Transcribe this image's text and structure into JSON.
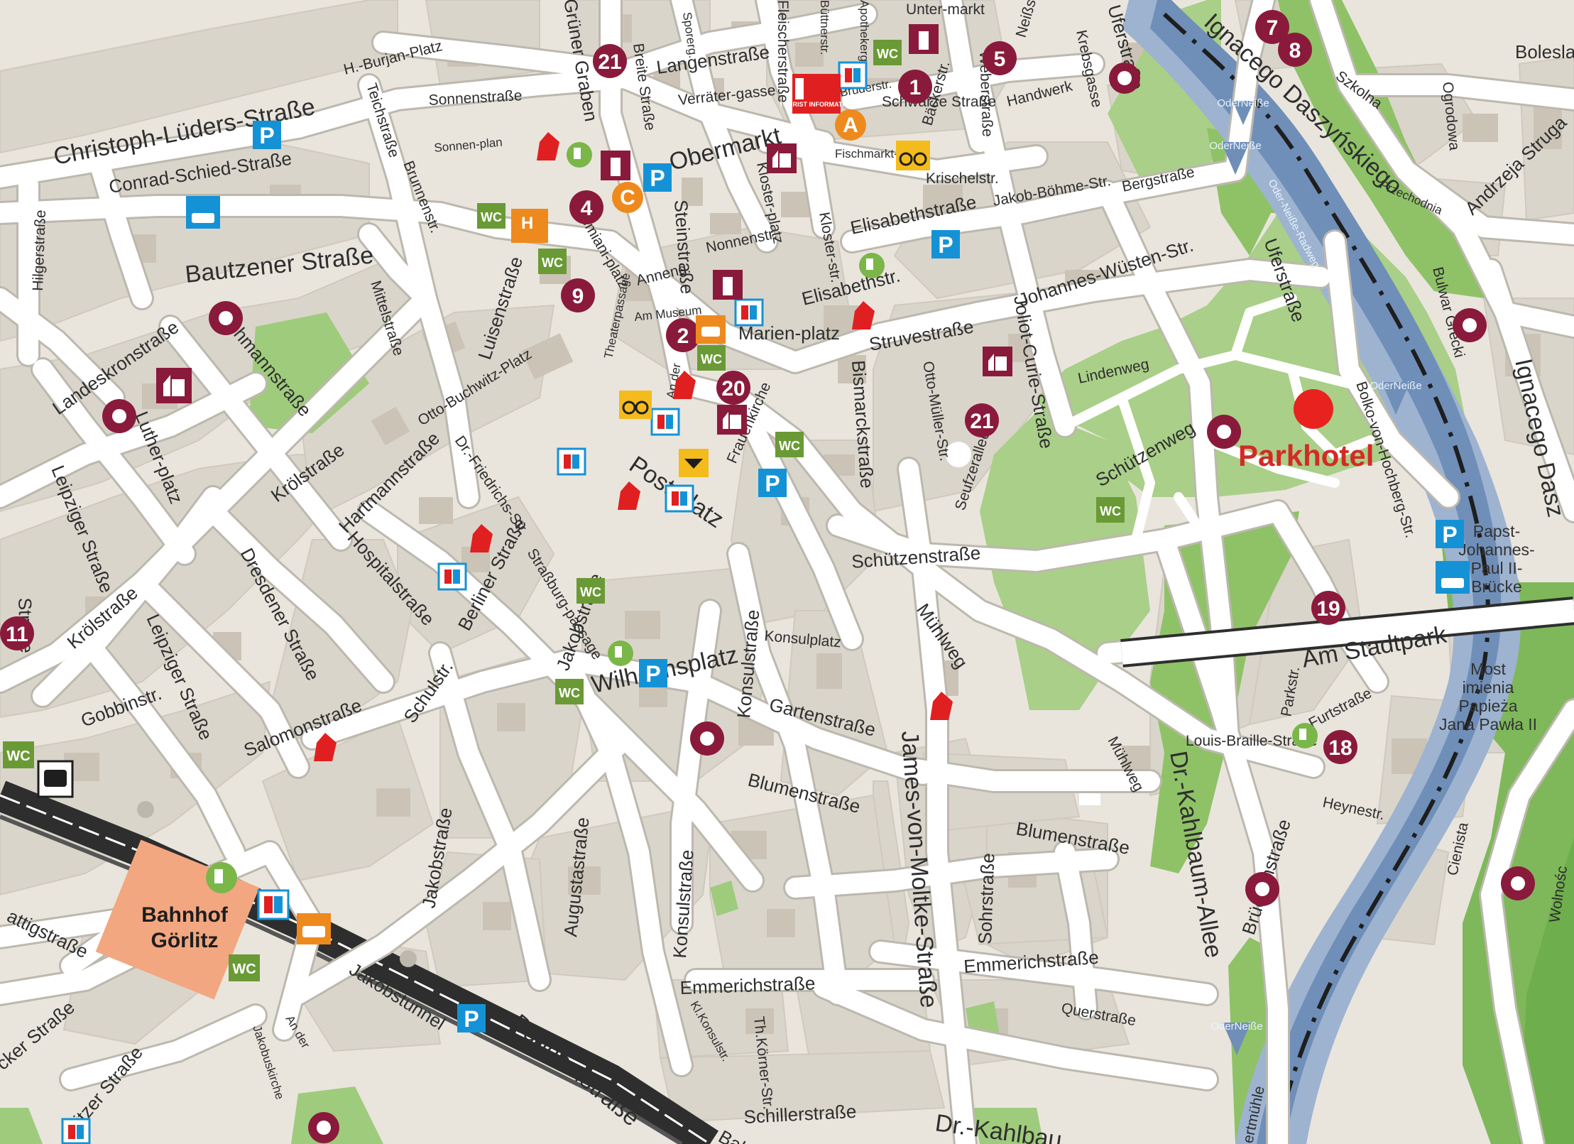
{
  "colors": {
    "background": "#e9e5dd",
    "block": "#dad5cb",
    "building": "#cfc8bc",
    "road": "#ffffff",
    "road_edge": "#bdb8ae",
    "park": "#8fc267",
    "park_light": "#b7d79c",
    "river": "#6f8fb8",
    "river_edge": "#9db3d0",
    "poi": "#8a1a3c",
    "parking": "#1592d6",
    "wc": "#6a9a35",
    "orange": "#ee8a1d",
    "yellow": "#f4bb1c",
    "pharmacy": "#e02020",
    "station": "#f3a780",
    "hotel": "#e8231f",
    "rail": "#2e2e2e"
  },
  "hotel": {
    "label": "Parkhotel"
  },
  "station": {
    "line1": "Bahnhof",
    "line2": "Görlitz"
  },
  "bridge": {
    "name_de": [
      "Papst-",
      "Johannes-",
      "Paul II-",
      "Brücke"
    ],
    "name_pl": [
      "Most",
      "imienia",
      "Papieża",
      "Jana Pawła II"
    ]
  },
  "river_label": "Oder-Neiße-Radweg",
  "bike_route_signs": [
    "OderNeiße",
    "OderNeiße",
    "OderNeiße",
    "OderNeiße"
  ],
  "streets": [
    "Christoph-Lüders-Straße",
    "Conrad-Schied-Straße",
    "H.-Burjan-Platz",
    "Sonnenstraße",
    "Teichstraße",
    "Brunnenstr.",
    "Sonnen-plan",
    "Hilgerstraße",
    "Bautzener Straße",
    "Mittelstraße",
    "Luisenstraße",
    "Jochmannstraße",
    "Landeskronstraße",
    "Luther-platz",
    "Otto-Buchwitz-Platz",
    "Krölstraße",
    "Hartmannstraße",
    "Dr.-Friedrichs-Str.",
    "Hospitalstraße",
    "Berliner Straße",
    "Leipziger Straße",
    "Dresdener Straße",
    "Krölstraße",
    "Leipziger Straße",
    "Gobbinstr.",
    "Salomonstraße",
    "Schulstr.",
    "Straße",
    "Jakobstraße",
    "Augustastraße",
    "Konsulstraße",
    "Straßburg-passage",
    "Jakobstraße",
    "Wilhelmsplatz",
    "Konsulstraße",
    "Konsulplatz",
    "Gartenstraße",
    "Blumenstraße",
    "Blumenstraße",
    "Sohrstraße",
    "James-von-Moltke-Straße",
    "Mühlweg",
    "Mühlweg",
    "Schützenstraße",
    "Dr.-Kahlbaum-Allee",
    "Emmerichstraße",
    "Emmerichstraße",
    "Querstraße",
    "Kl.Konsulstr.",
    "Th.Körner-Str.",
    "Schillerstraße",
    "Dr.-Kahlbau",
    "Bahnhofstraße",
    "Jakobstunnel",
    "Jakobuskirche",
    "An der",
    "witzer Straße",
    "cker Straße",
    "attigstraße",
    "Bah",
    "Obermarkt",
    "Demiani-platz",
    "Steinstraße",
    "Anneng.",
    "Nonnenstr.",
    "Kloster-platz",
    "Kloster-str.",
    "Am Museum",
    "Marien-platz",
    "Elisabethstraße",
    "Elisabethstr.",
    "Johannes-Wüsten-Str.",
    "Struvestraße",
    "Bismarckstraße",
    "Otto-Müller-Str.",
    "Seufzerallee",
    "Joliot-Curie-Straße",
    "Lindenweg",
    "Schützenweg",
    "Uferstraße",
    "Uferstraße",
    "Bergstraße",
    "Jakob-Böhme-Str.",
    "Krischelstr.",
    "Fischmarkt-str.",
    "Bäckerstr.",
    "Schwarze Straße",
    "Handwerk",
    "Weberstraße",
    "Neißstr.",
    "Krebsgasse",
    "Unter-markt",
    "Brüderstr.",
    "Apothekergasse",
    "Büttnerstr.",
    "Fleischerstraße",
    "Verräter-gasse",
    "Langenstraße",
    "Breite Straße",
    "Sporerg.",
    "Grüner Graben",
    "Theaterpassage",
    "An der",
    "Frauenkirche",
    "Post-platz",
    "Am Stadtpark",
    "Parkstr.",
    "Furtstraße",
    "Louis-Braille-Straße",
    "Heynestr.",
    "Brückenstraße",
    "Bolko-von-Hochberg-Str.",
    "Boleslawa",
    "Szkolna",
    "Ogrodowa",
    "Andrzeja Struga",
    "Ignacego Daszyńskiego",
    "Bulwar Grecki",
    "Ignacego Dasz",
    "Przechodnia",
    "Cienista",
    "Wolnośc",
    "ertmühle"
  ],
  "poi_numbers": [
    "21",
    "1",
    "5",
    "7",
    "8",
    "4",
    "9",
    "2",
    "20",
    "21",
    "19",
    "18",
    "11"
  ],
  "letter_markers": [
    "A",
    "C"
  ],
  "icons": [
    "parking-icon",
    "wc-icon",
    "bus-icon",
    "pharmacy-icon",
    "atm-icon",
    "ev-charging-icon",
    "bicycle-icon",
    "taxi-icon",
    "post-icon",
    "church-icon",
    "theatre-icon",
    "tower-icon",
    "tourist-info-icon",
    "hotel-icon"
  ],
  "tourist_info": "TOURIST INFORMATION",
  "sq_labels": {
    "parking": "P",
    "wc": "WC",
    "hotel": "H"
  }
}
